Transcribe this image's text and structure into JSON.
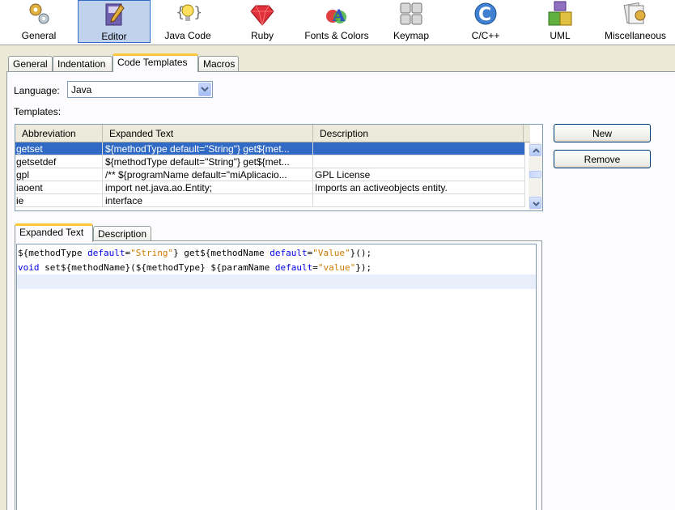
{
  "toolbar": {
    "categories": [
      {
        "label": "General",
        "icon": "gears-icon"
      },
      {
        "label": "Editor",
        "icon": "editor-book-icon"
      },
      {
        "label": "Java Code",
        "icon": "lightbulb-icon"
      },
      {
        "label": "Ruby",
        "icon": "ruby-gem-icon"
      },
      {
        "label": "Fonts & Colors",
        "icon": "fonts-colors-icon"
      },
      {
        "label": "Keymap",
        "icon": "keyboard-icon"
      },
      {
        "label": "C/C++",
        "icon": "c-cpp-icon"
      },
      {
        "label": "UML",
        "icon": "uml-icon"
      },
      {
        "label": "Miscellaneous",
        "icon": "miscellaneous-icon"
      }
    ],
    "selected": "Editor"
  },
  "tabs": {
    "general": "General",
    "indentation": "Indentation",
    "code_templates": "Code Templates",
    "macros": "Macros"
  },
  "language": {
    "label": "Language:",
    "value": "Java"
  },
  "templates": {
    "label": "Templates:",
    "columns": [
      "Abbreviation",
      "Expanded Text",
      "Description"
    ],
    "rows": [
      {
        "abbr": "getset",
        "text": "${methodType default=\"String\"} get${met...",
        "desc": ""
      },
      {
        "abbr": "getsetdef",
        "text": "${methodType default=\"String\"} get${met...",
        "desc": ""
      },
      {
        "abbr": "gpl",
        "text": "/** ${programName default=\"miAplicacio...",
        "desc": "GPL License"
      },
      {
        "abbr": "iaoent",
        "text": "import net.java.ao.Entity;",
        "desc": "Imports an activeobjects entity."
      },
      {
        "abbr": "ie",
        "text": "interface",
        "desc": ""
      }
    ]
  },
  "buttons": {
    "new": "New",
    "remove": "Remove"
  },
  "detail_tabs": {
    "expanded_text": "Expanded Text",
    "description": "Description"
  },
  "editor": {
    "line1": {
      "a": "${methodType ",
      "b": "default",
      "c": "=",
      "d": "\"String\"",
      "e": "} get${methodName ",
      "f": "default",
      "g": "=",
      "h": "\"Value\"",
      "i": "}();"
    },
    "line2": {
      "a": "void",
      "b": " set${methodName}(${methodType} ${paramName ",
      "c": "default",
      "d": "=",
      "e": "\"value\"",
      "f": "});"
    }
  },
  "colors": {
    "selection": "#316ac5",
    "keyword": "#0000e6",
    "string": "#ce7b00",
    "active_tab_accent": "#ffc83c"
  }
}
